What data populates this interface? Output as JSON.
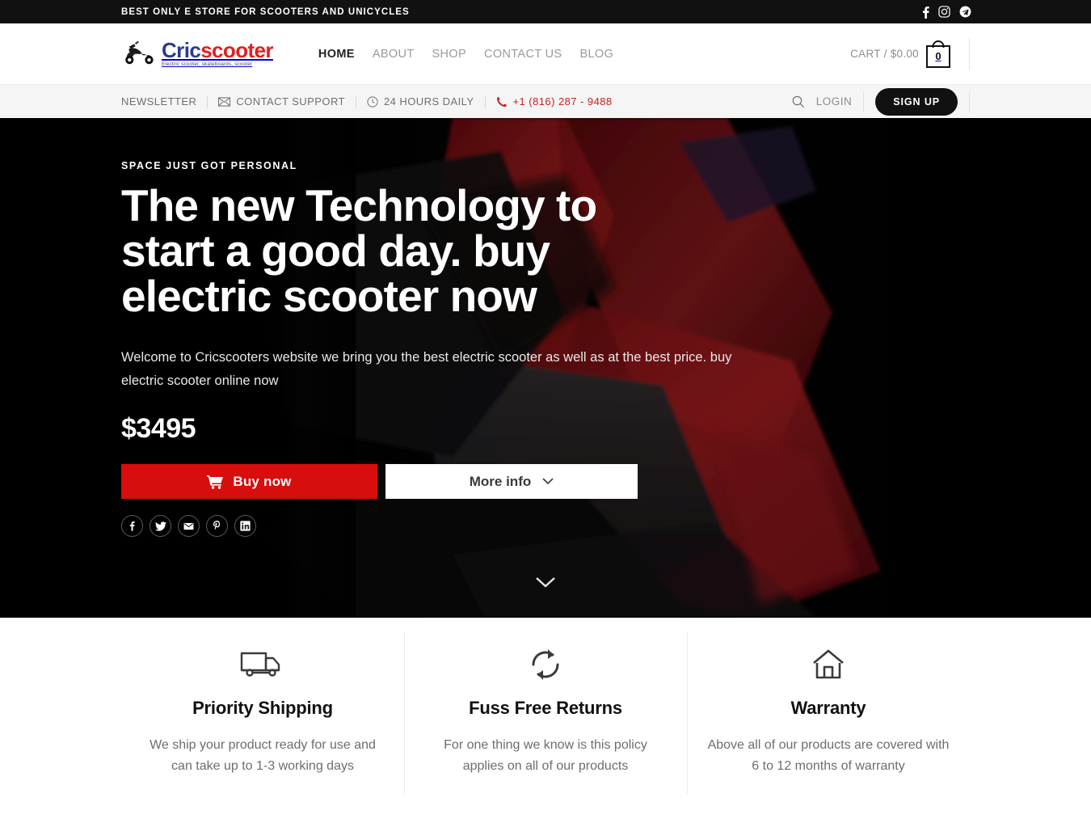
{
  "topbar": {
    "announcement": "BEST ONLY E STORE FOR SCOOTERS AND UNICYCLES",
    "social": [
      {
        "name": "facebook-icon",
        "label": "Facebook"
      },
      {
        "name": "instagram-icon",
        "label": "Instagram"
      },
      {
        "name": "telegram-icon",
        "label": "Telegram"
      }
    ]
  },
  "header": {
    "logo": {
      "word_part1": "Cric",
      "word_part2": "scooter",
      "tagline": "Electric scooter, skateboards, scooter",
      "color_part1": "#2b3a8f",
      "color_part2": "#e02020"
    },
    "nav": [
      {
        "label": "HOME",
        "active": true
      },
      {
        "label": "ABOUT",
        "active": false
      },
      {
        "label": "SHOP",
        "active": false
      },
      {
        "label": "CONTACT US",
        "active": false
      },
      {
        "label": "BLOG",
        "active": false
      }
    ],
    "cart": {
      "label": "CART / $0.00",
      "count": "0"
    }
  },
  "infobar": {
    "newsletter": "NEWSLETTER",
    "contact_support": "CONTACT SUPPORT",
    "hours": "24 HOURS DAILY",
    "phone": "+1 (816) 287 - 9488",
    "login": "LOGIN",
    "signup": "SIGN UP"
  },
  "hero": {
    "eyebrow": "SPACE JUST GOT PERSONAL",
    "title": "The new Technology to start a good day. buy electric scooter now",
    "description": "Welcome to Cricscooters website we bring you the best electric scooter as well as at the best price. buy electric scooter online now",
    "price": "$3495",
    "buy_button": "Buy now",
    "more_button": "More info",
    "share": [
      {
        "name": "share-facebook-icon",
        "label": "Facebook"
      },
      {
        "name": "share-twitter-icon",
        "label": "Twitter"
      },
      {
        "name": "share-email-icon",
        "label": "Email"
      },
      {
        "name": "share-pinterest-icon",
        "label": "Pinterest"
      },
      {
        "name": "share-linkedin-icon",
        "label": "LinkedIn"
      }
    ],
    "accent_color": "#d80d0d",
    "background_color": "#000000"
  },
  "features": [
    {
      "icon": "truck-icon",
      "title": "Priority Shipping",
      "text": "We ship your product ready for use and can take up to 1-3 working days"
    },
    {
      "icon": "refresh-icon",
      "title": "Fuss Free Returns",
      "text": "For one thing we know is this policy applies on all of our products"
    },
    {
      "icon": "home-icon",
      "title": "Warranty",
      "text": "Above all of our products are covered with 6 to 12 months of warranty"
    }
  ]
}
